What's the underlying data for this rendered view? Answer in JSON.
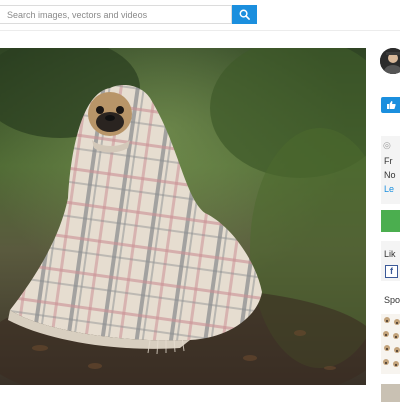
{
  "search": {
    "placeholder": "Search images, vectors and videos",
    "button_icon": "search-icon"
  },
  "photo": {
    "subject": "pug wrapped in a plaid blanket on a forest path"
  },
  "sidebar": {
    "like_button_icon": "thumbs-up-icon",
    "info_lines": [
      "Fr",
      "No",
      "Le"
    ],
    "info_icon": "clock-icon",
    "like_label": "Lik",
    "facebook_icon": "facebook-icon",
    "facebook_letter": "f",
    "sponsored_label": "Spo"
  },
  "colors": {
    "accent": "#1b8fde",
    "download": "#4bae4f",
    "card_bg": "#f4f4f4"
  }
}
